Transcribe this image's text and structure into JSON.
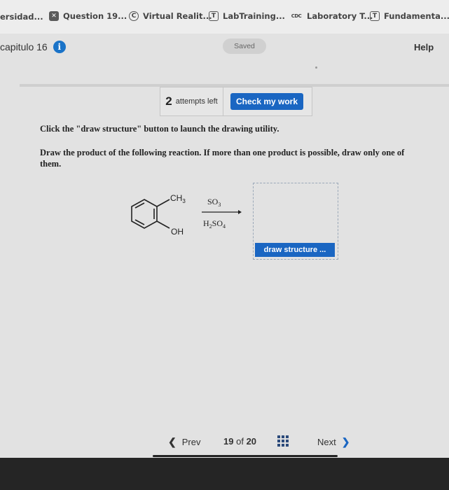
{
  "bookmarks": [
    {
      "label": "ersidad...",
      "icon": "none",
      "icon_text": ""
    },
    {
      "label": "Question 19...",
      "icon": "close-box-icon",
      "icon_text": "✕"
    },
    {
      "label": "Virtual Realit...",
      "icon": "c-box-icon",
      "icon_text": "C"
    },
    {
      "label": "LabTraining...",
      "icon": "t-box-icon",
      "icon_text": "T"
    },
    {
      "label": "Laboratory T...",
      "icon": "cdc-logo",
      "icon_text": "CDC"
    },
    {
      "label": "Fundamenta...",
      "icon": "t-box-icon",
      "icon_text": "T"
    }
  ],
  "header": {
    "chapter": "capitulo 16",
    "saved": "Saved",
    "help": "Help"
  },
  "attempts": {
    "count": "2",
    "label": "attempts left"
  },
  "check_button": "Check my work",
  "instruction": "Click the \"draw structure\" button to launch the drawing utility.",
  "question": "Draw the product of the following reaction. If more than one product is possible, draw only one of them.",
  "reaction": {
    "substituent_top": "CH3",
    "substituent_bottom": "OH",
    "reagent_top": "SO3",
    "reagent_bottom": "H2SO4"
  },
  "draw_button": "draw structure ...",
  "nav": {
    "prev": "Prev",
    "current": "19",
    "of": "of",
    "total": "20",
    "next": "Next"
  },
  "colors": {
    "accent": "#1a66c2",
    "info": "#1a73c8"
  }
}
